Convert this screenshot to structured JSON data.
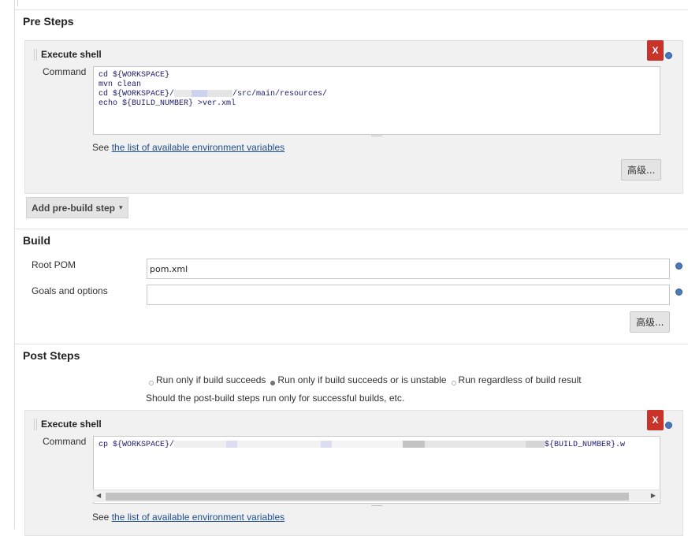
{
  "pre_steps": {
    "title": "Pre Steps",
    "step": {
      "title": "Execute shell",
      "delete_label": "X",
      "command_label": "Command",
      "command_lines": [
        "cd ${WORKSPACE}",
        "mvn clean",
        "cd ${WORKSPACE}/",
        "/src/main/resources/",
        "echo ${BUILD_NUMBER} >ver.xml"
      ],
      "env_hint_prefix": "See ",
      "env_hint_link": "the list of available environment variables",
      "advanced_label": "高级..."
    },
    "add_step_label": "Add pre-build step",
    "add_step_caret": "▾"
  },
  "build": {
    "title": "Build",
    "root_pom_label": "Root POM",
    "root_pom_value": "pom.xml",
    "goals_label": "Goals and options",
    "goals_value": "",
    "advanced_label": "高级..."
  },
  "post_steps": {
    "title": "Post Steps",
    "options": [
      {
        "label": "Run only if build succeeds",
        "checked": false
      },
      {
        "label": "Run only if build succeeds or is unstable",
        "checked": true
      },
      {
        "label": "Run regardless of build result",
        "checked": false
      }
    ],
    "description": "Should the post-build steps run only for successful builds, etc.",
    "step": {
      "title": "Execute shell",
      "delete_label": "X",
      "command_label": "Command",
      "command_start": "cp ${WORKSPACE}/",
      "command_end": "${BUILD_NUMBER}.w",
      "env_hint_prefix": "See ",
      "env_hint_link": "the list of available environment variables"
    }
  },
  "icons": {
    "delete": "close-icon",
    "help": "help-icon",
    "dropdown": "chevron-down-icon",
    "scroll_left": "arrow-left-icon",
    "scroll_right": "arrow-right-icon"
  },
  "colors": {
    "delete_button": "#c9332a",
    "help_icon": "#4a78b8",
    "link": "#1f4f8f",
    "step_background": "#f1f1f1"
  }
}
